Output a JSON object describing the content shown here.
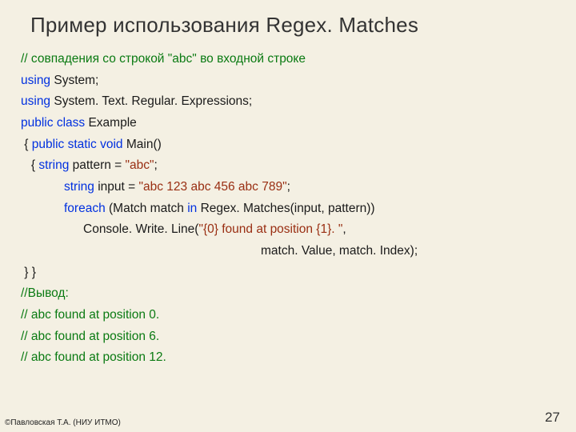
{
  "title": "Пример использования Regex. Matches",
  "code": {
    "c1": "// совпадения со строкой \"abc\" во входной строке",
    "u1a": "using",
    "u1b": " System;",
    "u2a": "using",
    "u2b": " System. Text. Regular. Expressions;",
    "p1a": "public",
    "p1b": "class",
    "p1c": " Example",
    "l5a": " { ",
    "l5b": "public",
    "l5c": "static",
    "l5d": "void",
    "l5e": " Main()",
    "l6a": "   { ",
    "l6b": "string",
    "l6c": " pattern = ",
    "l6d": "\"abc\"",
    "l6e": ";",
    "l7a": "string",
    "l7b": " input = ",
    "l7c": "\"abc 123 abc 456 abc 789\"",
    "l7d": ";",
    "l8a": "foreach",
    "l8b": " (Match match ",
    "l8c": "in",
    "l8d": " Regex. Matches(input, pattern))",
    "l9a": "Console. Write. Line(",
    "l9b": "\"{0} found at position {1}. \"",
    "l9c": ",",
    "l10": "match. Value, match. Index);",
    "l11": " } }",
    "o1": "//Вывод: ",
    "o2": "// abc found at position 0. ",
    "o3": "// abc found at position 6. ",
    "o4": "// abc found at position 12. "
  },
  "footer_left": "©Павловская Т.А. (НИУ ИТМО)",
  "page_num": "27"
}
